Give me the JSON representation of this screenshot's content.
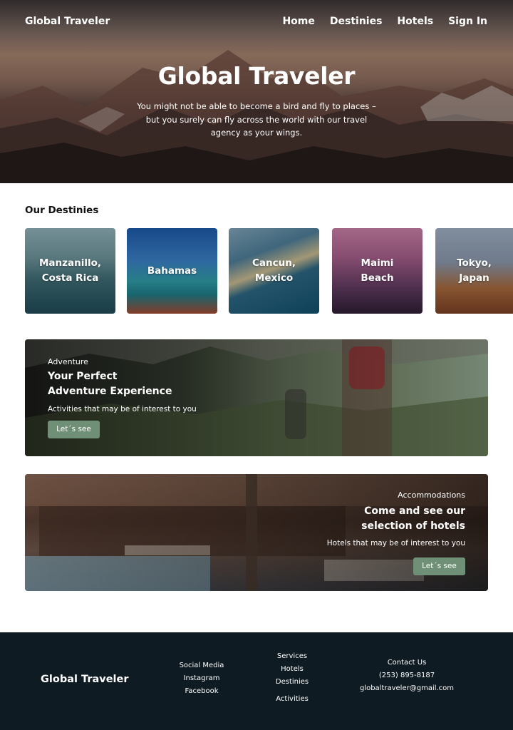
{
  "header": {
    "brand": "Global Traveler",
    "nav": [
      "Home",
      "Destinies",
      "Hotels",
      "Sign In"
    ]
  },
  "hero": {
    "title": "Global Traveler",
    "subtitle": "You might not be able to become a bird and fly to places – but you surely can fly across the world with our travel agency as your wings."
  },
  "destinies": {
    "title": "Our Destinies",
    "items": [
      {
        "label": "Manzanillo,\nCosta Rica"
      },
      {
        "label": "Bahamas"
      },
      {
        "label": "Cancun,\nMexico"
      },
      {
        "label": "Maimi\nBeach"
      },
      {
        "label": "Tokyo,\nJapan"
      }
    ]
  },
  "adventure": {
    "kicker": "Adventure",
    "heading": "Your Perfect\nAdventure Experience",
    "desc": "Activities that may be of interest to you",
    "button": "Let´s see"
  },
  "hotels": {
    "kicker": "Accommodations",
    "heading": "Come and see our\nselection of hotels",
    "desc": "Hotels that may be of interest to you",
    "button": "Let´s see"
  },
  "footer": {
    "brand": "Global Traveler",
    "social": [
      "Social Media",
      "Instagram",
      "Facebook"
    ],
    "services": [
      "Services",
      "Hotels",
      "Destinies",
      "Activities"
    ],
    "contact": [
      "Contact Us",
      "(253) 895-8187",
      "globaltraveler@gmail.com"
    ]
  },
  "colors": {
    "button": "#6f8f76",
    "footer_bg": "#0f1b22"
  }
}
